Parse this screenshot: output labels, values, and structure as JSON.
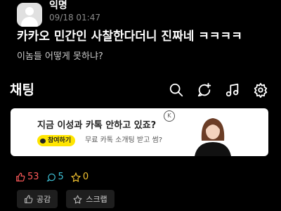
{
  "post": {
    "author": "익명",
    "time": "09/18 01:47",
    "title": "카카오 민간인 사찰한다더니 진짜네 ㅋㅋㅋㅋ",
    "body": "이놈들 어떻게 못하냐?"
  },
  "section": {
    "title": "채팅",
    "icons": [
      "search-icon",
      "add-chat-icon",
      "music-icon",
      "gear-icon"
    ]
  },
  "ad": {
    "headline": "지금 이성과 카톡 안하고 있죠?",
    "button_label": "참여하기",
    "subtext": "무료 카톡 소개팅 받고 썸?",
    "logo_text": "K"
  },
  "stats": {
    "likes": "53",
    "comments": "5",
    "scraps": "0",
    "colors": {
      "likes": "#ff5a5a",
      "comments": "#3fc1d6",
      "scraps": "#f2c230"
    }
  },
  "actions": {
    "like_label": "공감",
    "scrap_label": "스크랩"
  }
}
